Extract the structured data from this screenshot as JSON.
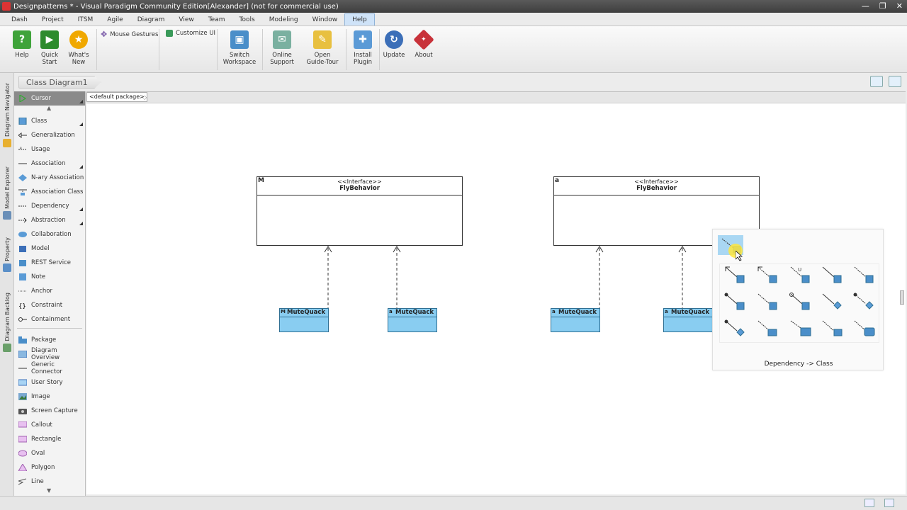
{
  "window": {
    "title": "Designpatterns * - Visual Paradigm Community Edition[Alexander] (not for commercial use)",
    "controls": [
      "—",
      "❐",
      "✕"
    ]
  },
  "menubar": [
    "Dash",
    "Project",
    "ITSM",
    "Agile",
    "Diagram",
    "View",
    "Team",
    "Tools",
    "Modeling",
    "Window",
    "Help"
  ],
  "ribbon": {
    "help": "Help",
    "quick_start": [
      "Quick",
      "Start"
    ],
    "whats_new": [
      "What's",
      "New"
    ],
    "mouse_gestures": "Mouse Gestures",
    "customize_ui": "Customize UI",
    "switch_workspace": [
      "Switch",
      "Workspace"
    ],
    "online_support": [
      "Online",
      "Support"
    ],
    "open_guide_tour": [
      "Open",
      "Guide-Tour"
    ],
    "install_plugin": [
      "Install",
      "Plugin"
    ],
    "update": "Update",
    "about": "About"
  },
  "side_tabs": [
    "Diagram Navigator",
    "Model Explorer",
    "Property",
    "Diagram Backlog"
  ],
  "diagram": {
    "name": "Class Diagram1",
    "package": "<default package>",
    "package_close": "◇"
  },
  "palette": [
    {
      "label": "Cursor",
      "icon": "cursor-icon"
    },
    {
      "label": "Class",
      "icon": "class-icon"
    },
    {
      "label": "Generalization",
      "icon": "generalization-icon"
    },
    {
      "label": "Usage",
      "icon": "usage-icon"
    },
    {
      "label": "Association",
      "icon": "association-icon"
    },
    {
      "label": "N-ary Association",
      "icon": "nary-association-icon"
    },
    {
      "label": "Association Class",
      "icon": "association-class-icon"
    },
    {
      "label": "Dependency",
      "icon": "dependency-icon"
    },
    {
      "label": "Abstraction",
      "icon": "abstraction-icon"
    },
    {
      "label": "Collaboration",
      "icon": "collaboration-icon"
    },
    {
      "label": "Model",
      "icon": "model-icon"
    },
    {
      "label": "REST Service",
      "icon": "rest-service-icon"
    },
    {
      "label": "Note",
      "icon": "note-icon"
    },
    {
      "label": "Anchor",
      "icon": "anchor-icon"
    },
    {
      "label": "Constraint",
      "icon": "constraint-icon"
    },
    {
      "label": "Containment",
      "icon": "containment-icon"
    },
    {
      "label": "Package",
      "icon": "package-icon"
    },
    {
      "label": "Diagram Overview",
      "icon": "diagram-overview-icon"
    },
    {
      "label": "Generic Connector",
      "icon": "generic-connector-icon"
    },
    {
      "label": "User Story",
      "icon": "user-story-icon"
    },
    {
      "label": "Image",
      "icon": "image-icon"
    },
    {
      "label": "Screen Capture",
      "icon": "screen-capture-icon"
    },
    {
      "label": "Callout",
      "icon": "callout-icon"
    },
    {
      "label": "Rectangle",
      "icon": "rectangle-icon"
    },
    {
      "label": "Oval",
      "icon": "oval-icon"
    },
    {
      "label": "Polygon",
      "icon": "polygon-icon"
    },
    {
      "label": "Line",
      "icon": "line-icon"
    }
  ],
  "interfaces": [
    {
      "stereotype": "<<Interface>>",
      "name": "FlyBehavior",
      "tag": "M"
    },
    {
      "stereotype": "<<Interface>>",
      "name": "FlyBehavior",
      "tag": "a"
    }
  ],
  "classes": [
    {
      "name": "MuteQuack",
      "tag": "M"
    },
    {
      "name": "MuteQuack",
      "tag": "a"
    },
    {
      "name": "MuteQuack",
      "tag": "a"
    },
    {
      "name": "MuteQuack",
      "tag": "a"
    }
  ],
  "popup": {
    "caption": "Dependency -> Class"
  },
  "colors": {
    "class_fill": "#89cdf1",
    "selection": "#a9d7f3",
    "accent_menu": "#cfe3f8"
  }
}
